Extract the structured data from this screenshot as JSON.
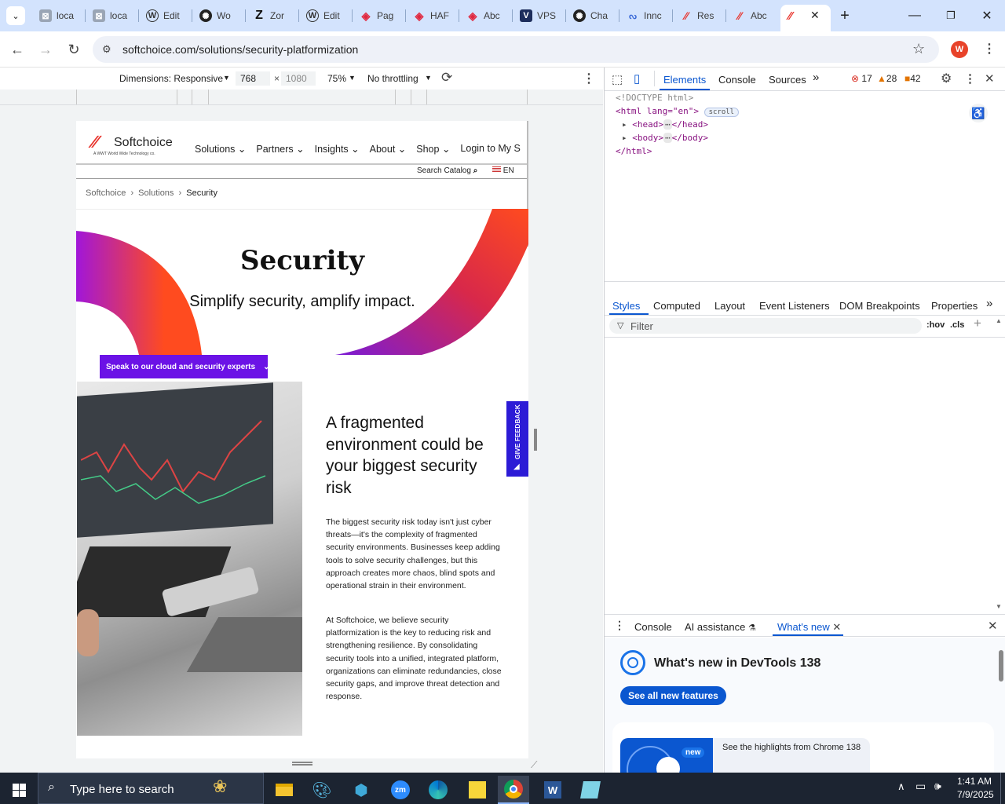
{
  "browser": {
    "tabs": [
      {
        "label": "loca",
        "icon": "generic-page-icon"
      },
      {
        "label": "loca",
        "icon": "generic-page-icon"
      },
      {
        "label": "Edit",
        "icon": "wordpress-icon"
      },
      {
        "label": "Wo",
        "icon": "openai-icon"
      },
      {
        "label": "Zor",
        "icon": "zoro-icon"
      },
      {
        "label": "Edit",
        "icon": "wordpress-icon"
      },
      {
        "label": "Pag",
        "icon": "diamond-icon"
      },
      {
        "label": "HAF",
        "icon": "diamond-icon"
      },
      {
        "label": "Abc",
        "icon": "diamond-icon"
      },
      {
        "label": "VPS",
        "icon": "vps-icon"
      },
      {
        "label": "Cha",
        "icon": "openai-icon"
      },
      {
        "label": "Innc",
        "icon": "innovation-icon"
      },
      {
        "label": "Res",
        "icon": "softchoice-icon"
      },
      {
        "label": "Abc",
        "icon": "softchoice-icon"
      }
    ],
    "new_tab": "+",
    "url": "softchoice.com/solutions/security-platformization",
    "profile_initial": "W"
  },
  "devicebar": {
    "dimensions_label": "Dimensions: Responsive",
    "width": "768",
    "times": "×",
    "height": "1080",
    "zoom": "75%",
    "throttling": "No throttling"
  },
  "site": {
    "logo_name": "Softchoice",
    "logo_tagline": "A WWT World Wide Technology co.",
    "nav": [
      "Solutions",
      "Partners",
      "Insights",
      "About",
      "Shop",
      "Login to My S"
    ],
    "search_catalog": "Search Catalog",
    "lang": "EN",
    "breadcrumb": [
      "Softchoice",
      "Solutions",
      "Security"
    ],
    "hero_title": "Security",
    "hero_subtitle": "Simplify security, amplify impact.",
    "cta": "Speak to our cloud and security experts",
    "section_heading": "A fragmented environment could be your biggest security risk",
    "para1": "The biggest security risk today isn't just cyber threats—it's the complexity of fragmented security environments. Businesses keep adding tools to solve security challenges, but this approach creates more chaos, blind spots and operational strain in their environment.",
    "para2": "At Softchoice, we believe security platformization is the key to reducing risk and strengthening resilience. By consolidating security tools into a unified, integrated platform, organizations can eliminate redundancies, close security gaps, and improve threat detection and response.",
    "feedback": "GIVE FEEDBACK"
  },
  "devtools": {
    "tabs": [
      "Elements",
      "Console",
      "Sources"
    ],
    "errors": "17",
    "warnings": "28",
    "issues": "42",
    "dom": {
      "doctype": "<!DOCTYPE html>",
      "html_open": "<html lang=\"en\">",
      "scroll_badge": "scroll",
      "head": "<head>",
      "head_close": "</head>",
      "body": "<body>",
      "body_close": "</body>",
      "html_close": "</html>"
    },
    "style_tabs": [
      "Styles",
      "Computed",
      "Layout",
      "Event Listeners",
      "DOM Breakpoints",
      "Properties"
    ],
    "filter_placeholder": "Filter",
    "hov": ":hov",
    "cls": ".cls",
    "drawer_tabs": [
      "Console",
      "AI assistance",
      "What's new"
    ],
    "whats_new_title": "What's new in DevTools 138",
    "see_all": "See all new features",
    "new_badge": "new",
    "highlights": "See the highlights from Chrome 138"
  },
  "taskbar": {
    "search_placeholder": "Type here to search",
    "time": "1:41 AM",
    "date": "7/9/2025"
  },
  "colors": {
    "accent_purple": "#6b12e6",
    "softchoice_red": "#e8322b",
    "devtools_blue": "#0b57d0",
    "taskbar": "#1c2431"
  }
}
